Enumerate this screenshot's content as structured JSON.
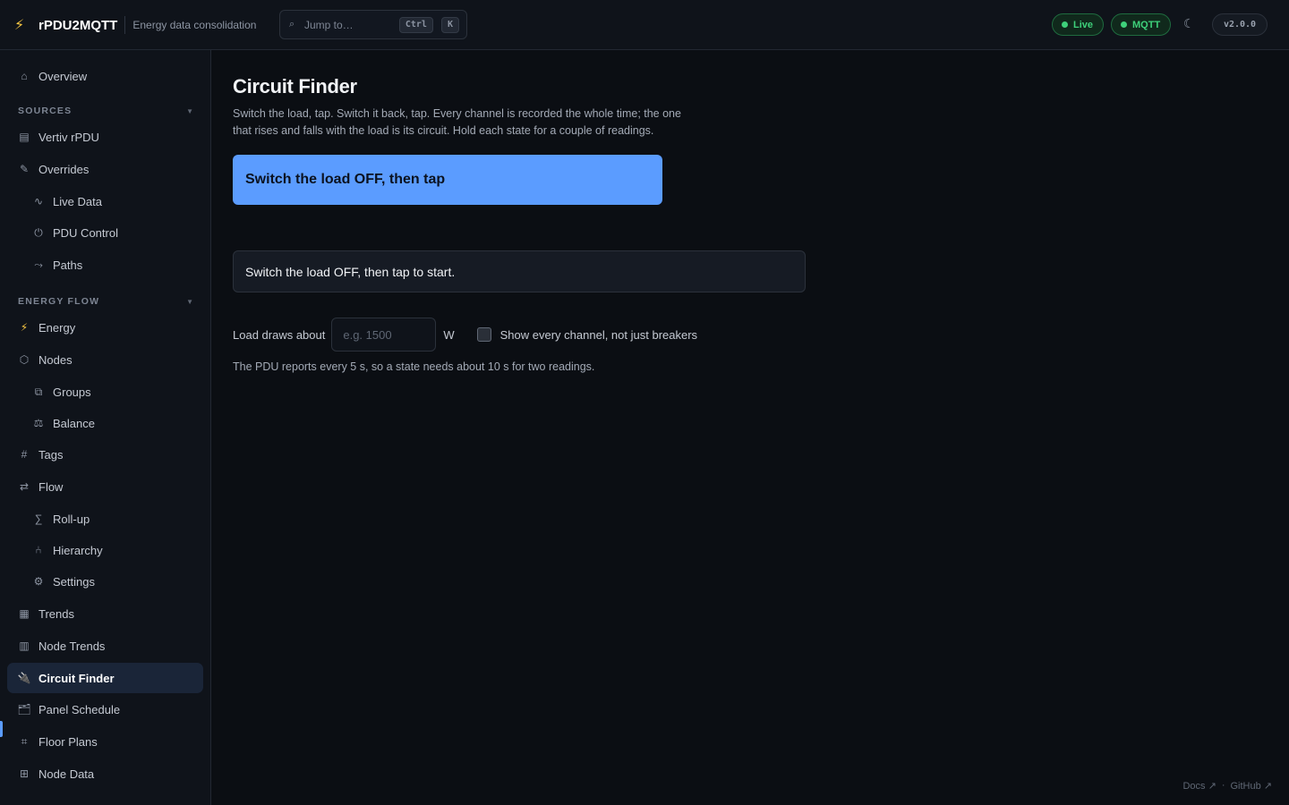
{
  "app": {
    "name": "rPDU2MQTT",
    "tagline": "Energy data consolidation",
    "version": "v2.0.0"
  },
  "topbar": {
    "search_placeholder": "Jump to…",
    "shortcut_mod": "Ctrl",
    "shortcut_key": "K",
    "status_live": "Live",
    "status_mqtt": "MQTT",
    "status_color": "#3ed07a"
  },
  "sidebar": {
    "overview": "Overview",
    "sections": {
      "sources": "SOURCES",
      "energy_flow": "ENERGY FLOW"
    },
    "items": {
      "vertiv_rpdu": "Vertiv rPDU",
      "overrides": "Overrides",
      "live_data": "Live Data",
      "pdu_control": "PDU Control",
      "paths": "Paths",
      "energy": "Energy",
      "nodes": "Nodes",
      "groups": "Groups",
      "balance": "Balance",
      "tags": "Tags",
      "flow": "Flow",
      "rollup": "Roll-up",
      "hierarchy": "Hierarchy",
      "settings": "Settings",
      "trends": "Trends",
      "node_trends": "Node Trends",
      "circuit_finder": "Circuit Finder",
      "panel_schedule": "Panel Schedule",
      "floor_plans": "Floor Plans",
      "node_data": "Node Data"
    },
    "active": "circuit_finder"
  },
  "main": {
    "title": "Circuit Finder",
    "description": "Switch the load, tap. Switch it back, tap. Every channel is recorded the whole time; the one that rises and falls with the load is its circuit. Hold each state for a couple of readings.",
    "action_button": "Switch the load OFF, then tap",
    "status_message": "Switch the load OFF, then tap to start.",
    "load_label": "Load draws about",
    "load_placeholder": "e.g. 1500",
    "load_value": "",
    "load_unit": "W",
    "show_all_label": "Show every channel, not just breakers",
    "show_all_checked": false,
    "hint": "The PDU reports every 5 s, so a state needs about 10 s for two readings.",
    "accent_color": "#5b9cff"
  },
  "footer": {
    "docs": "Docs ↗",
    "separator": "·",
    "github": "GitHub ↗"
  }
}
